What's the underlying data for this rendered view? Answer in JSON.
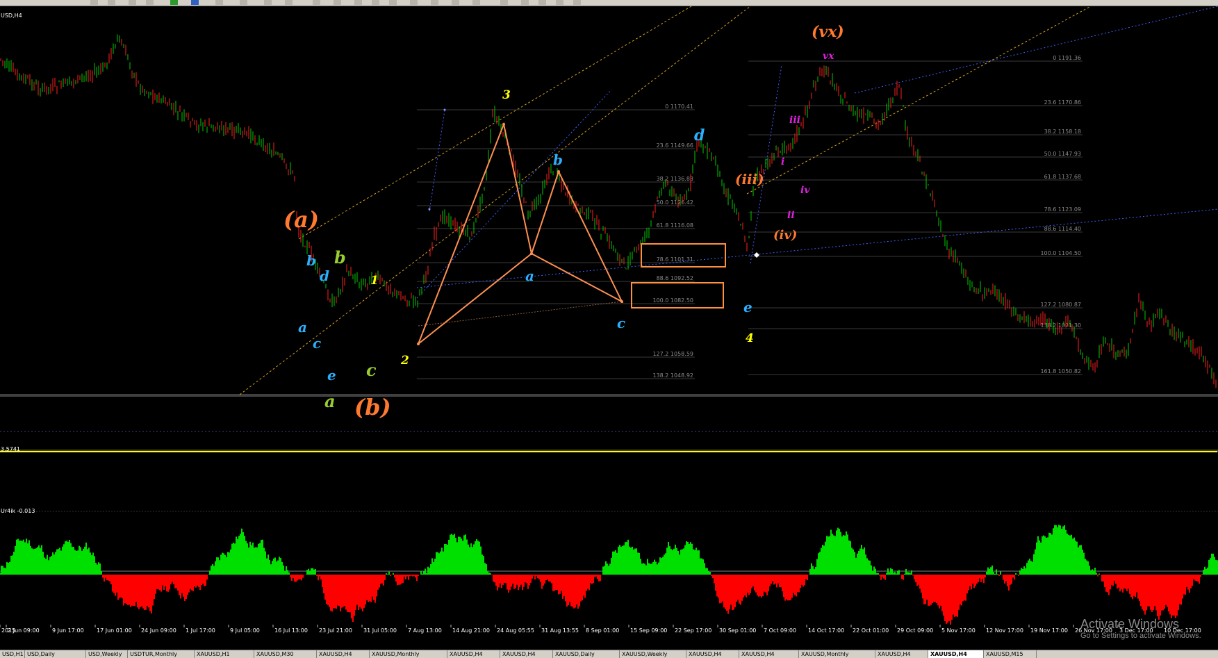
{
  "chart": {
    "symbol_label": "USD,H4",
    "price_up_color": "#00cc00",
    "price_down_color": "#ff2020",
    "osc1_label": "3.5741",
    "osc1_color": "#ffff00",
    "osc2_label": "Ur4ik -0.013",
    "osc2_pos_color": "#00e000",
    "osc2_neg_color": "#ff0000",
    "channel_color": "#d4a020",
    "trendline_color": "#4060ff",
    "pattern_color": "#ff9050",
    "box_color": "#ff9040"
  },
  "fib_levels": [
    {
      "label": "0 1170.41"
    },
    {
      "label": "23.6 1149.66"
    },
    {
      "label": "38.2 1136.83"
    },
    {
      "label": "50.0 1126.42"
    },
    {
      "label": "61.8 1116.08"
    },
    {
      "label": "78.6 1101.31"
    },
    {
      "label": "88.6 1092.52"
    },
    {
      "label": "100.0 1082.50"
    },
    {
      "label": "127.2 1058.59"
    },
    {
      "label": "138.2 1048.92"
    },
    {
      "label": "0 1191.36"
    },
    {
      "label": "23.6 1170.86"
    },
    {
      "label": "38.2 1158.18"
    },
    {
      "label": "50.0 1147.93"
    },
    {
      "label": "61.8 1137.68"
    },
    {
      "label": "78.6 1123.09"
    },
    {
      "label": "88.6 1114.40"
    },
    {
      "label": "100.0 1104.50"
    },
    {
      "label": "127.2 1080.87"
    },
    {
      "label": "138.2 1071.30"
    },
    {
      "label": "161.8 1050.82"
    }
  ],
  "wave_labels": [
    {
      "text": "(a)",
      "color": "#ff7a30"
    },
    {
      "text": "(b)",
      "color": "#ff7a30"
    },
    {
      "text": "(iii)",
      "color": "#ff7a30"
    },
    {
      "text": "(iv)",
      "color": "#ff7a30"
    },
    {
      "text": "(vx)",
      "color": "#ff7a30"
    },
    {
      "text": "vx",
      "color": "#e020e0"
    },
    {
      "text": "iii",
      "color": "#e020e0"
    },
    {
      "text": "i",
      "color": "#e020e0"
    },
    {
      "text": "iv",
      "color": "#e020e0"
    },
    {
      "text": "ii",
      "color": "#e020e0"
    },
    {
      "text": "1",
      "color": "#ffff00"
    },
    {
      "text": "2",
      "color": "#ffff00"
    },
    {
      "text": "3",
      "color": "#ffff00"
    },
    {
      "text": "4",
      "color": "#ffff00"
    },
    {
      "text": "b",
      "color": "#2ab0ff"
    },
    {
      "text": "d",
      "color": "#2ab0ff"
    },
    {
      "text": "a",
      "color": "#2ab0ff"
    },
    {
      "text": "c",
      "color": "#2ab0ff"
    },
    {
      "text": "e",
      "color": "#2ab0ff"
    },
    {
      "text": "b",
      "color": "#9acd32"
    },
    {
      "text": "c",
      "color": "#9acd32"
    },
    {
      "text": "a",
      "color": "#9acd32"
    },
    {
      "text": "a",
      "color": "#2ab0ff"
    },
    {
      "text": "b",
      "color": "#2ab0ff"
    },
    {
      "text": "c",
      "color": "#2ab0ff"
    },
    {
      "text": "d",
      "color": "#2ab0ff"
    },
    {
      "text": "e",
      "color": "#2ab0ff"
    }
  ],
  "time_axis": [
    "2015",
    "2 Jun 09:00",
    "9 Jun 17:00",
    "17 Jun 01:00",
    "24 Jun 09:00",
    "1 Jul 17:00",
    "9 Jul 05:00",
    "16 Jul 13:00",
    "23 Jul 21:00",
    "31 Jul 05:00",
    "7 Aug 13:00",
    "14 Aug 21:00",
    "24 Aug 05:55",
    "31 Aug 13:55",
    "8 Sep 01:00",
    "15 Sep 09:00",
    "22 Sep 17:00",
    "30 Sep 01:00",
    "7 Oct 09:00",
    "14 Oct 17:00",
    "22 Oct 01:00",
    "29 Oct 09:00",
    "5 Nov 17:00",
    "12 Nov 17:00",
    "19 Nov 17:00",
    "26 Nov 17:00",
    "3 Dec 17:00",
    "10 Dec 17:00"
  ],
  "tabs": [
    "USD,H1",
    "USD,Daily",
    "USD,Weekly",
    "USDTUR,Monthly",
    "XAUUSD,H1",
    "XAUUSD,M30",
    "XAUUSD,H4",
    "XAUUSD,Monthly",
    "XAUUSD,H4",
    "XAUUSD,H4",
    "XAUUSD,Daily",
    "XAUUSD,Weekly",
    "XAUUSD,H4",
    "XAUUSD,H4",
    "XAUUSD,Monthly",
    "XAUUSD,H4",
    "XAUUSD,H4",
    "XAUUSD,M15"
  ],
  "active_tab": 16,
  "watermark": {
    "line1": "Activate Windows",
    "line2": "Go to Settings to activate Windows."
  }
}
